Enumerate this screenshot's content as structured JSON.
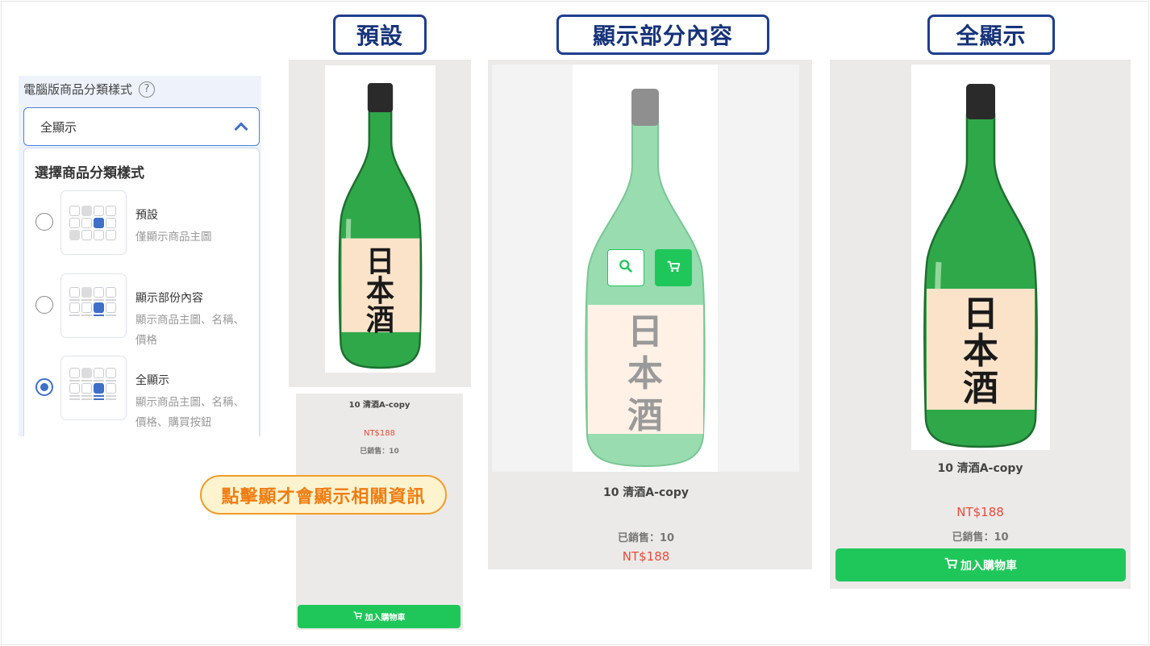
{
  "panel": {
    "label": "電腦版商品分類樣式",
    "help_icon": "?",
    "select_value": "全顯示",
    "dropdown_title": "選擇商品分類樣式",
    "options": [
      {
        "name": "預設",
        "desc": "僅顯示商品主圖",
        "selected": false
      },
      {
        "name": "顯示部份內容",
        "desc": "顯示商品主圖、名稱、價格",
        "selected": false
      },
      {
        "name": "全顯示",
        "desc": "顯示商品主圖、名稱、價格、購買按鈕",
        "selected": true
      }
    ]
  },
  "headers": {
    "default": "預設",
    "partial": "顯示部分內容",
    "full": "全顯示"
  },
  "product": {
    "title": "10 清酒A-copy",
    "price": "NT$188",
    "sold": "已銷售：10",
    "cart_label": "加入購物車",
    "label_text": [
      "日",
      "本",
      "酒"
    ]
  },
  "note": "點擊顯才會顯示相關資訊",
  "colors": {
    "accent_blue": "#3f6fc9",
    "header_navy": "#1e3f8f",
    "green": "#1fc75a",
    "price_red": "#e74c3c",
    "note_orange": "#f07d12"
  }
}
